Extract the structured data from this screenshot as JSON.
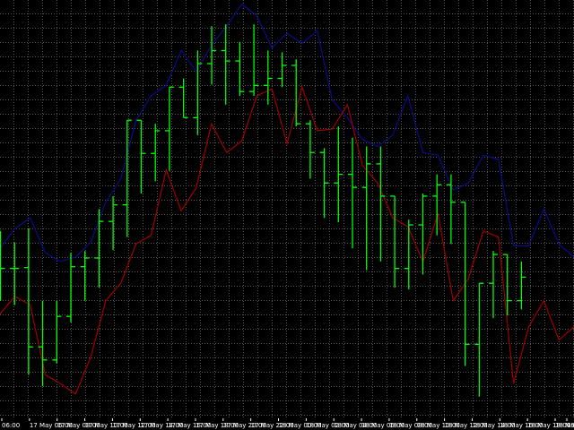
{
  "chart_data": {
    "type": "ohlc",
    "ylim": [
      0,
      480
    ],
    "grid": true,
    "colors": {
      "background": "#000000",
      "grid": "#5a5a5a",
      "bars": "#00ff00",
      "upper_line": "#0c0c8a",
      "lower_line": "#a00000",
      "text": "#ffffff"
    },
    "x_tick_labels": [
      "06:00",
      "17 May 06:00",
      "17 May 08:00",
      "17 May 10:00",
      "17 May 12:00",
      "17 May 14:00",
      "17 May 16:00",
      "17 May 18:00",
      "17 May 20:00",
      "17 May 22:00",
      "18 May 00:00",
      "18 May 02:00",
      "18 May 04:00",
      "18 May 06:00",
      "18 May 08:00",
      "18 May 10:00",
      "18 May 12:00",
      "18 May 14:00",
      "18 May 16:00",
      "18 May 18:00",
      "18 May 20:00",
      "18 May 22:00",
      "19"
    ],
    "bars": [
      {
        "open": 308,
        "high": 265,
        "low": 345,
        "close": 308
      },
      {
        "open": 308,
        "high": 278,
        "low": 350,
        "close": 308
      },
      {
        "open": 307,
        "high": 262,
        "low": 430,
        "close": 398
      },
      {
        "open": 398,
        "high": 345,
        "low": 443,
        "close": 413
      },
      {
        "open": 413,
        "high": 345,
        "low": 417,
        "close": 363
      },
      {
        "open": 363,
        "high": 290,
        "low": 370,
        "close": 306
      },
      {
        "open": 306,
        "high": 288,
        "low": 345,
        "close": 296
      },
      {
        "open": 296,
        "high": 240,
        "low": 330,
        "close": 254
      },
      {
        "open": 254,
        "high": 225,
        "low": 287,
        "close": 235
      },
      {
        "open": 235,
        "high": 138,
        "low": 272,
        "close": 138
      },
      {
        "open": 138,
        "high": 138,
        "low": 222,
        "close": 176
      },
      {
        "open": 176,
        "high": 142,
        "low": 208,
        "close": 150
      },
      {
        "open": 150,
        "high": 100,
        "low": 196,
        "close": 100
      },
      {
        "open": 100,
        "high": 90,
        "low": 135,
        "close": 135
      },
      {
        "open": 135,
        "high": 58,
        "low": 155,
        "close": 73
      },
      {
        "open": 73,
        "high": 30,
        "low": 97,
        "close": 58
      },
      {
        "open": 58,
        "high": 28,
        "low": 120,
        "close": 70
      },
      {
        "open": 70,
        "high": 48,
        "low": 110,
        "close": 105
      },
      {
        "open": 105,
        "high": 28,
        "low": 110,
        "close": 98
      },
      {
        "open": 98,
        "high": 58,
        "low": 120,
        "close": 90
      },
      {
        "open": 90,
        "high": 60,
        "low": 100,
        "close": 75
      },
      {
        "open": 75,
        "high": 68,
        "low": 145,
        "close": 142
      },
      {
        "open": 142,
        "high": 138,
        "low": 205,
        "close": 175
      },
      {
        "open": 175,
        "high": 170,
        "low": 250,
        "close": 210
      },
      {
        "open": 210,
        "high": 145,
        "low": 255,
        "close": 200
      },
      {
        "open": 200,
        "high": 158,
        "low": 285,
        "close": 215
      },
      {
        "open": 215,
        "high": 168,
        "low": 310,
        "close": 188
      },
      {
        "open": 188,
        "high": 168,
        "low": 300,
        "close": 225
      },
      {
        "open": 225,
        "high": 225,
        "low": 330,
        "close": 308
      },
      {
        "open": 308,
        "high": 252,
        "low": 332,
        "close": 258
      },
      {
        "open": 258,
        "high": 222,
        "low": 315,
        "close": 225
      },
      {
        "open": 225,
        "high": 200,
        "low": 270,
        "close": 212
      },
      {
        "open": 212,
        "high": 200,
        "low": 280,
        "close": 232
      },
      {
        "open": 232,
        "high": 265,
        "low": 420,
        "close": 395
      },
      {
        "open": 395,
        "high": 325,
        "low": 455,
        "close": 325
      },
      {
        "open": 325,
        "high": 288,
        "low": 365,
        "close": 292
      },
      {
        "open": 292,
        "high": 315,
        "low": 362,
        "close": 345
      },
      {
        "open": 345,
        "high": 300,
        "low": 355,
        "close": 318
      }
    ],
    "upper_line": [
      285,
      262,
      250,
      290,
      300,
      295,
      278,
      232,
      205,
      138,
      110,
      98,
      58,
      82,
      52,
      30,
      5,
      18,
      55,
      38,
      50,
      35,
      115,
      135,
      160,
      168,
      155,
      110,
      175,
      178,
      218,
      210,
      178,
      183,
      282,
      282,
      240,
      280,
      295
    ],
    "lower_line": [
      360,
      340,
      350,
      430,
      440,
      452,
      410,
      345,
      325,
      280,
      270,
      195,
      242,
      215,
      142,
      175,
      162,
      110,
      102,
      165,
      100,
      150,
      148,
      120,
      190,
      210,
      250,
      260,
      300,
      245,
      345,
      320,
      265,
      272,
      440,
      375,
      345,
      390,
      375
    ]
  }
}
